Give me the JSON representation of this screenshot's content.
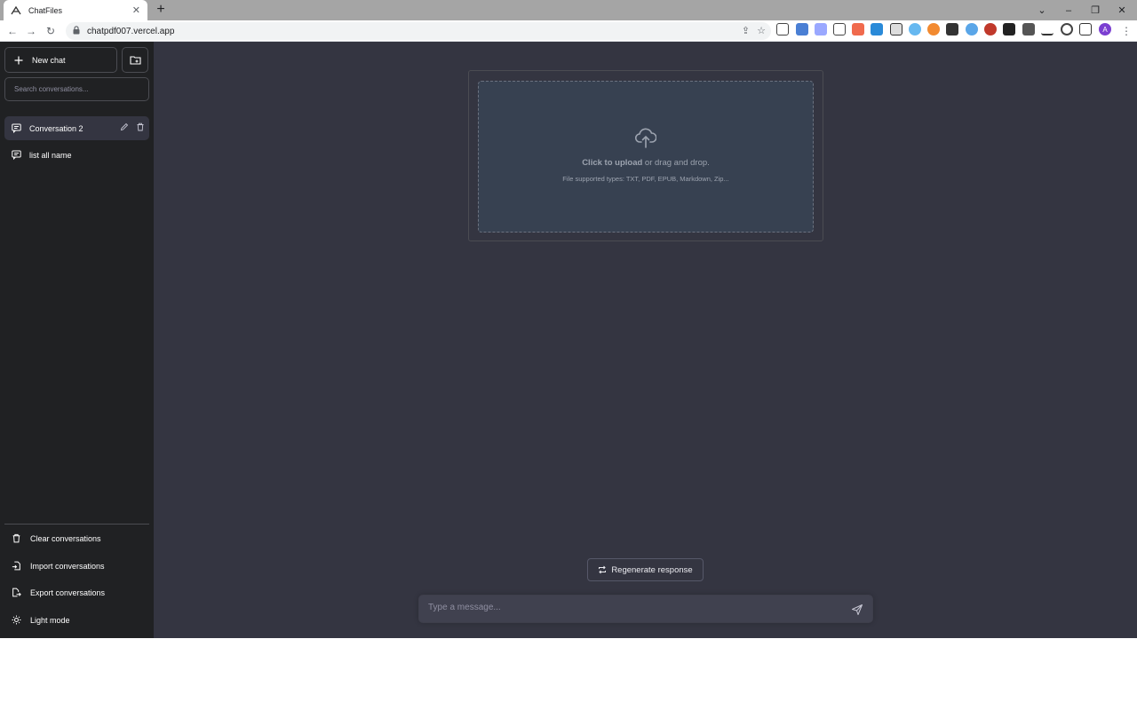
{
  "browser": {
    "tab_title": "ChatFiles",
    "url": "chatpdf007.vercel.app"
  },
  "sidebar": {
    "new_chat_label": "New chat",
    "search_placeholder": "Search conversations...",
    "conversations": [
      {
        "label": "Conversation 2",
        "active": true
      },
      {
        "label": "list all name",
        "active": false
      }
    ],
    "bottom": {
      "clear": "Clear conversations",
      "import": "Import conversations",
      "export": "Export conversations",
      "theme": "Light mode"
    }
  },
  "upload": {
    "cta_bold": "Click to upload",
    "cta_rest": " or drag and drop.",
    "supported": "File supported types: TXT, PDF, EPUB, Markdown, Zip..."
  },
  "chat": {
    "regenerate_label": "Regenerate response",
    "message_placeholder": "Type a message..."
  },
  "colors": {
    "sidebar_bg": "#202123",
    "main_bg": "#343541",
    "upload_bg": "#374151",
    "input_bg": "#40414f",
    "avatar": "#7b3fd1"
  }
}
